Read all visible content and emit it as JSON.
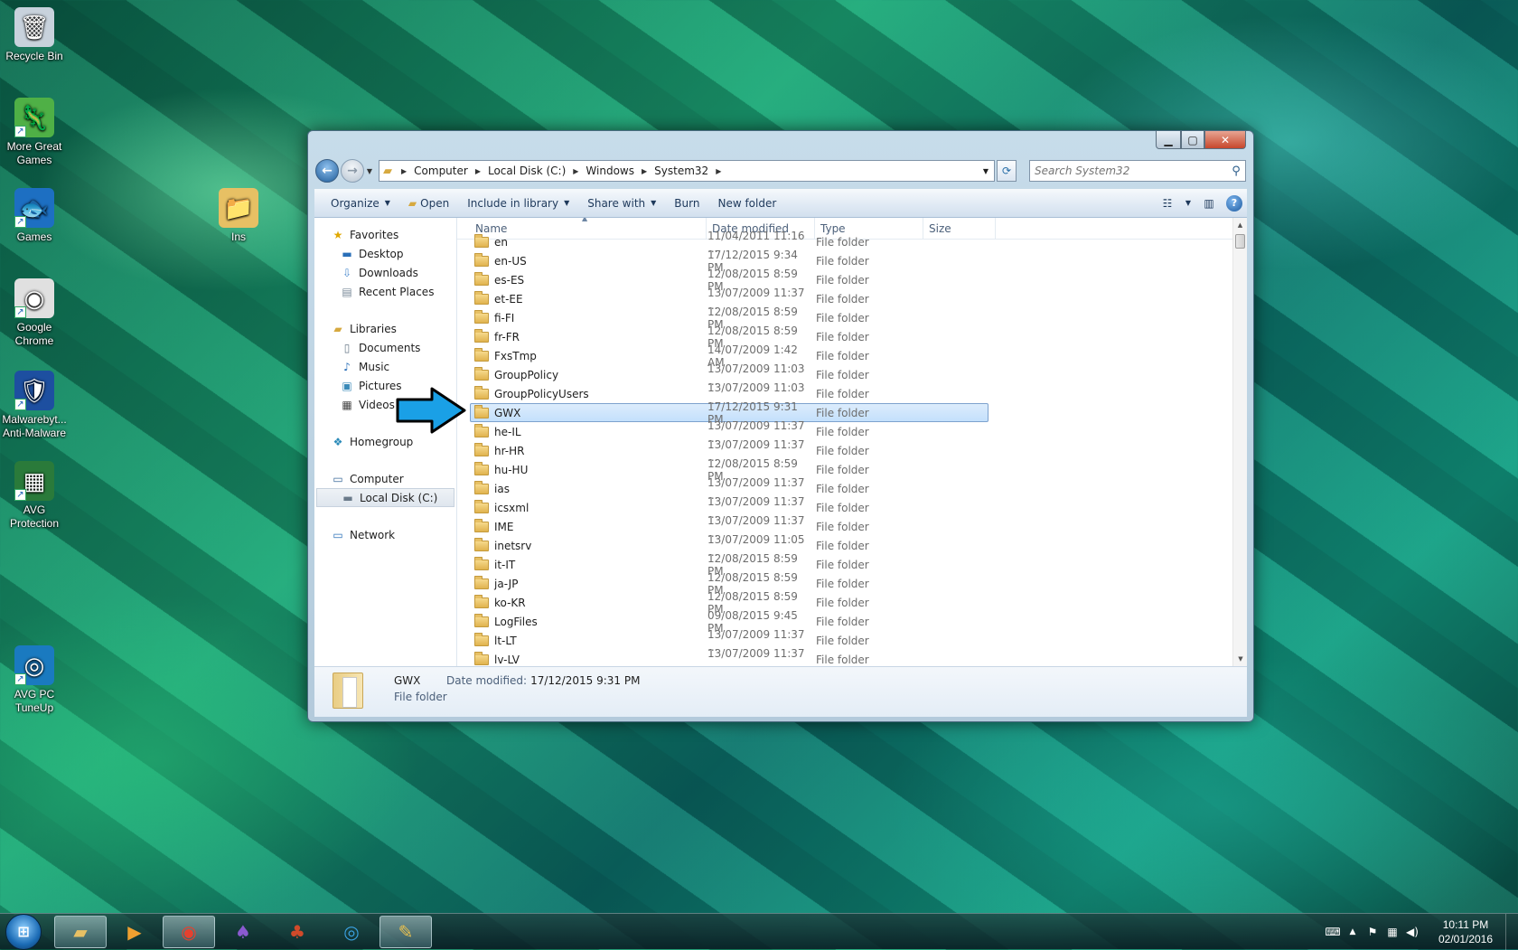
{
  "desktop": {
    "icons": [
      {
        "label": "Recycle Bin",
        "glyph": "🗑"
      },
      {
        "label": "More Great Games",
        "glyph": "🦎"
      },
      {
        "label": "Games",
        "glyph": "🐟"
      },
      {
        "label": "Google Chrome",
        "glyph": "◉"
      },
      {
        "label": "Malwarebyt... Anti-Malware",
        "glyph": "🛡"
      },
      {
        "label": "AVG Protection",
        "glyph": "▦"
      },
      {
        "label": "AVG PC TuneUp",
        "glyph": "◎"
      },
      {
        "label": "Ins",
        "glyph": "📁"
      }
    ]
  },
  "window": {
    "controls": {
      "minimize": "▁",
      "maximize": "▢",
      "close": "✕"
    },
    "address": {
      "crumbs": [
        "Computer",
        "Local Disk (C:)",
        "Windows",
        "System32"
      ]
    },
    "search": {
      "placeholder": "Search System32"
    },
    "toolbar": {
      "organize": "Organize",
      "open": "Open",
      "include_in_library": "Include in library",
      "share_with": "Share with",
      "burn": "Burn",
      "new_folder": "New folder"
    },
    "nav": {
      "favorites": "Favorites",
      "desktop": "Desktop",
      "downloads": "Downloads",
      "recent_places": "Recent Places",
      "libraries": "Libraries",
      "documents": "Documents",
      "music": "Music",
      "pictures": "Pictures",
      "videos": "Videos",
      "homegroup": "Homegroup",
      "computer": "Computer",
      "local_disk": "Local Disk (C:)",
      "network": "Network"
    },
    "columns": {
      "name": "Name",
      "date_modified": "Date modified",
      "type": "Type",
      "size": "Size"
    },
    "files": [
      {
        "name": "en",
        "date": "11/04/2011 11:16 ...",
        "type": "File folder"
      },
      {
        "name": "en-US",
        "date": "17/12/2015 9:34 PM",
        "type": "File folder"
      },
      {
        "name": "es-ES",
        "date": "12/08/2015 8:59 PM",
        "type": "File folder"
      },
      {
        "name": "et-EE",
        "date": "13/07/2009 11:37 ...",
        "type": "File folder"
      },
      {
        "name": "fi-FI",
        "date": "12/08/2015 8:59 PM",
        "type": "File folder"
      },
      {
        "name": "fr-FR",
        "date": "12/08/2015 8:59 PM",
        "type": "File folder"
      },
      {
        "name": "FxsTmp",
        "date": "14/07/2009 1:42 AM",
        "type": "File folder"
      },
      {
        "name": "GroupPolicy",
        "date": "13/07/2009 11:03 ...",
        "type": "File folder"
      },
      {
        "name": "GroupPolicyUsers",
        "date": "13/07/2009 11:03 ...",
        "type": "File folder"
      },
      {
        "name": "GWX",
        "date": "17/12/2015 9:31 PM",
        "type": "File folder"
      },
      {
        "name": "he-IL",
        "date": "13/07/2009 11:37 ...",
        "type": "File folder"
      },
      {
        "name": "hr-HR",
        "date": "13/07/2009 11:37 ...",
        "type": "File folder"
      },
      {
        "name": "hu-HU",
        "date": "12/08/2015 8:59 PM",
        "type": "File folder"
      },
      {
        "name": "ias",
        "date": "13/07/2009 11:37 ...",
        "type": "File folder"
      },
      {
        "name": "icsxml",
        "date": "13/07/2009 11:37 ...",
        "type": "File folder"
      },
      {
        "name": "IME",
        "date": "13/07/2009 11:37 ...",
        "type": "File folder"
      },
      {
        "name": "inetsrv",
        "date": "13/07/2009 11:05 ...",
        "type": "File folder"
      },
      {
        "name": "it-IT",
        "date": "12/08/2015 8:59 PM",
        "type": "File folder"
      },
      {
        "name": "ja-JP",
        "date": "12/08/2015 8:59 PM",
        "type": "File folder"
      },
      {
        "name": "ko-KR",
        "date": "12/08/2015 8:59 PM",
        "type": "File folder"
      },
      {
        "name": "LogFiles",
        "date": "09/08/2015 9:45 PM",
        "type": "File folder"
      },
      {
        "name": "lt-LT",
        "date": "13/07/2009 11:37 ...",
        "type": "File folder"
      },
      {
        "name": "lv-LV",
        "date": "13/07/2009 11:37 ...",
        "type": "File folder"
      }
    ],
    "selected_index": 9,
    "details": {
      "name": "GWX",
      "date_label": "Date modified:",
      "date_value": "17/12/2015 9:31 PM",
      "type": "File folder"
    }
  },
  "taskbar": {
    "clock_time": "10:11 PM",
    "clock_date": "02/01/2016",
    "apps": [
      "explorer-icon",
      "media-player-icon",
      "chrome-icon",
      "cards-icon",
      "solitaire-icon",
      "tuneup-icon",
      "paint-icon"
    ]
  },
  "colors": {
    "accent": "#1f5c9a",
    "selection": "#c4e0fc",
    "arrow": "#1aa0e6"
  }
}
